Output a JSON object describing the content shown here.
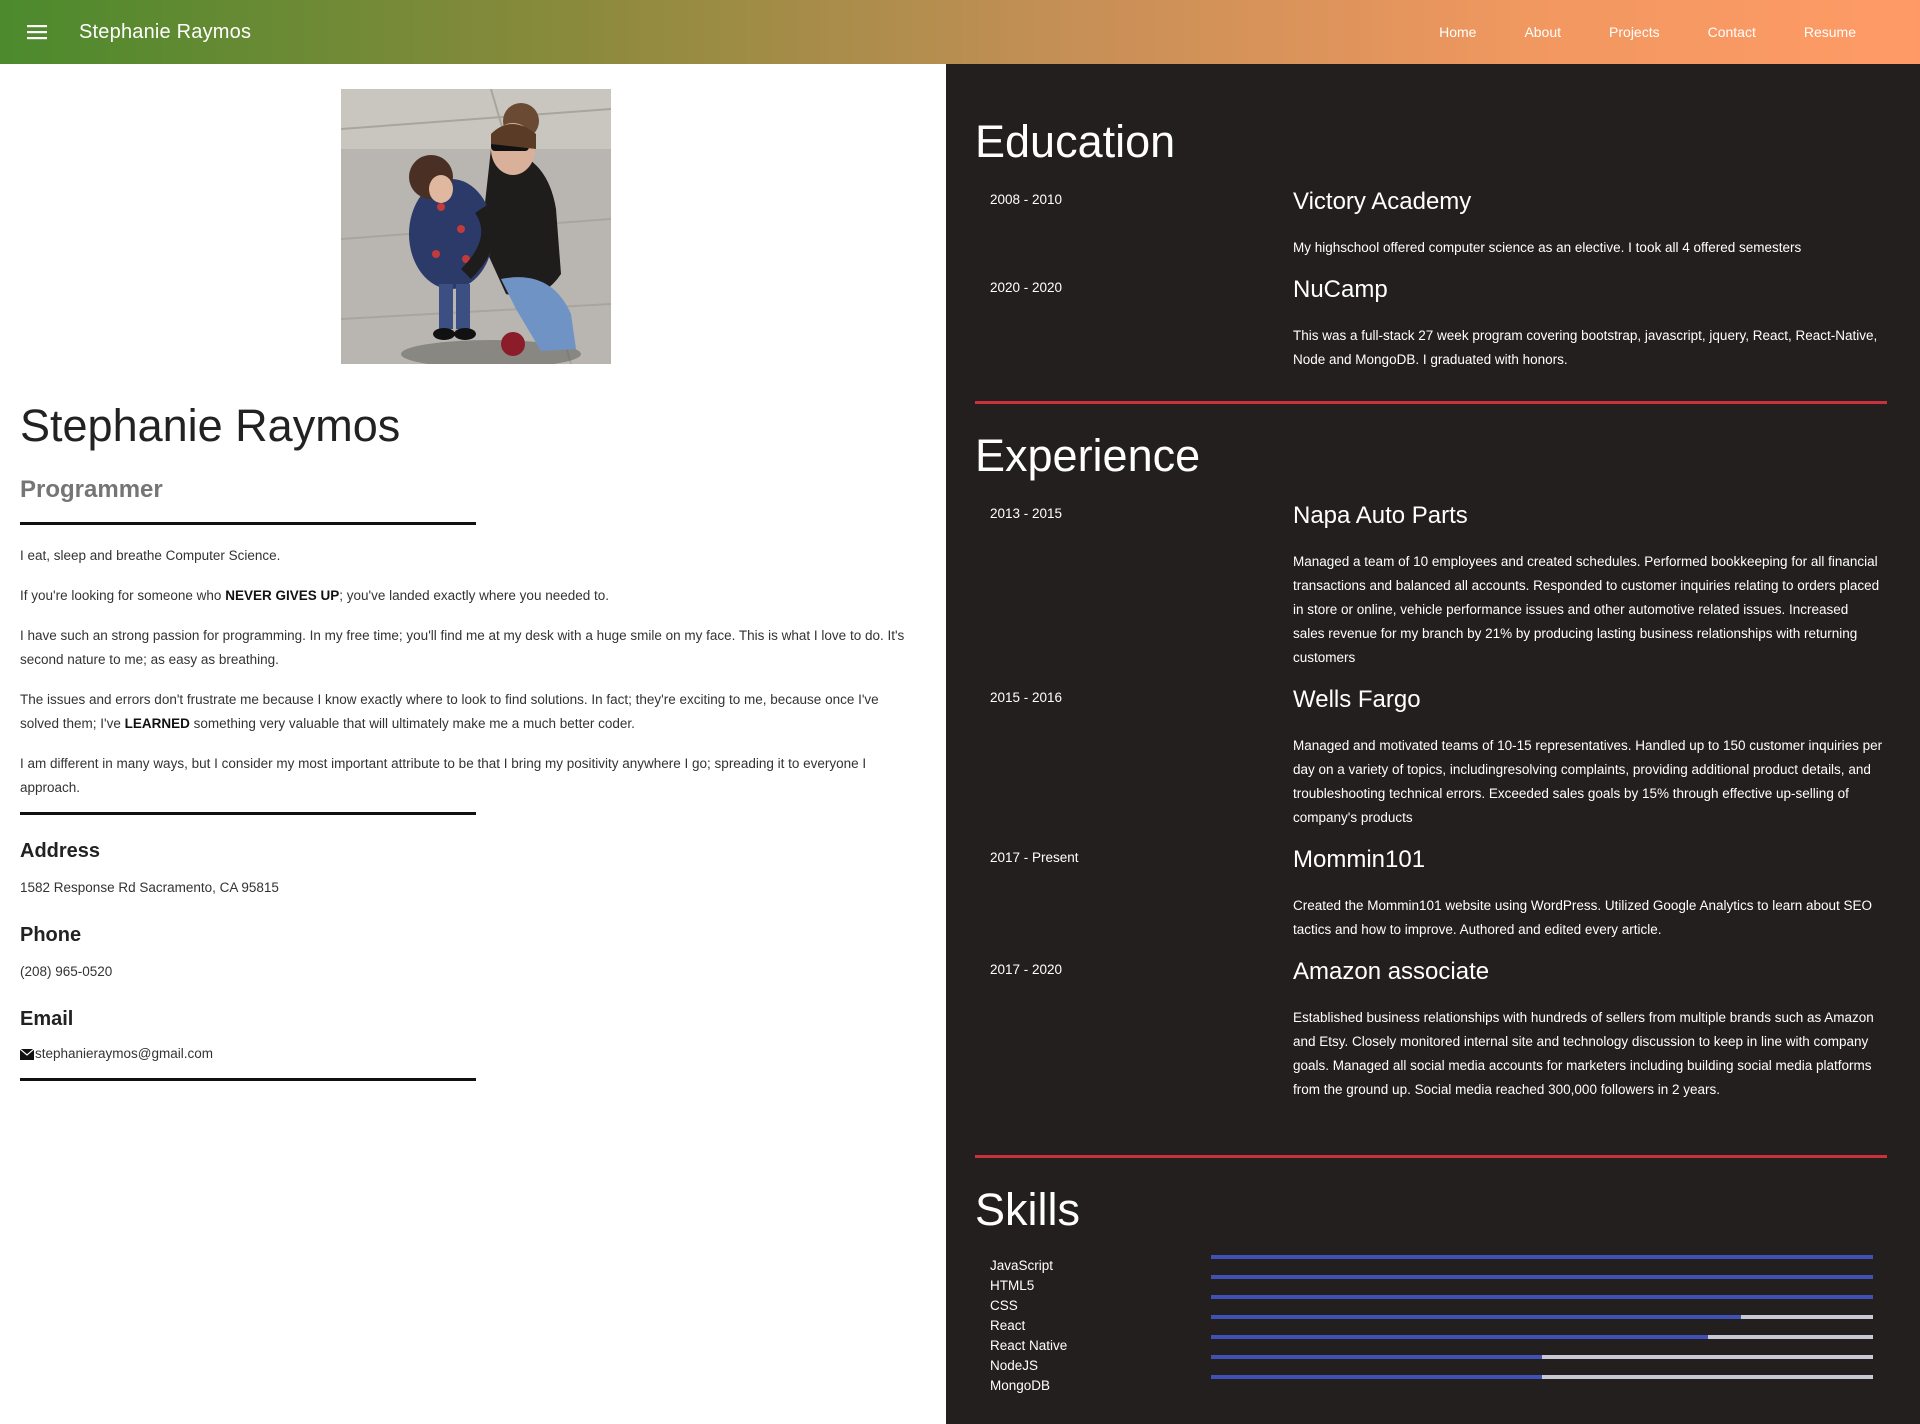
{
  "header": {
    "brand": "Stephanie Raymos",
    "nav": [
      "Home",
      "About",
      "Projects",
      "Contact",
      "Resume"
    ]
  },
  "profile": {
    "name": "Stephanie Raymos",
    "role": "Programmer",
    "bio": {
      "p1": "I eat, sleep and breathe Computer Science.",
      "p2_a": "If you're looking for someone who ",
      "p2_b": "NEVER GIVES UP",
      "p2_c": "; you've landed exactly where you needed to.",
      "p3": "I have such an strong passion for programming. In my free time; you'll find me at my desk with a huge smile on my face. This is what I love to do. It's second nature to me; as easy as breathing.",
      "p4_a": "The issues and errors don't frustrate me because I know exactly where to look to find solutions. In fact; they're exciting to me, because once I've solved them; I've ",
      "p4_b": "LEARNED",
      "p4_c": " something very valuable that will ultimately make me a much better coder.",
      "p5": "I am different in many ways, but I consider my most important attribute to be that I bring my positivity anywhere I go; spreading it to everyone I approach."
    },
    "address_label": "Address",
    "address": "1582 Response Rd Sacramento, CA 95815",
    "phone_label": "Phone",
    "phone": "(208) 965-0520",
    "email_label": "Email",
    "email": "stephanieraymos@gmail.com"
  },
  "education": {
    "title": "Education",
    "items": [
      {
        "dates": "2008 - 2010",
        "title": "Victory Academy",
        "desc": "My highschool offered computer science as an elective. I took all 4 offered semesters"
      },
      {
        "dates": "2020 - 2020",
        "title": "NuCamp",
        "desc": "This was a full-stack 27 week program covering bootstrap, javascript, jquery, React, React-Native, Node and MongoDB. I graduated with honors."
      }
    ]
  },
  "experience": {
    "title": "Experience",
    "items": [
      {
        "dates": "2013 - 2015",
        "title": "Napa Auto Parts",
        "desc": "Managed a team of 10 employees and created schedules. Performed bookkeeping for all financial transactions and balanced all accounts. Responded to customer inquiries relating to orders placed in store or online, vehicle performance issues and other automotive related issues. Increased sales revenue for my branch by 21% by producing lasting business relationships with returning customers"
      },
      {
        "dates": "2015 - 2016",
        "title": "Wells Fargo",
        "desc": "Managed and motivated teams of 10-15 representatives. Handled up to 150 customer inquiries per day on a variety of topics, includingresolving complaints, providing additional product details, and troubleshooting technical errors. Exceeded sales goals by 15% through effective up-selling of company's products"
      },
      {
        "dates": "2017 - Present",
        "title": "Mommin101",
        "desc": "Created the Mommin101 website using WordPress. Utilized Google Analytics to learn about SEO tactics and how to improve. Authored and edited every article."
      },
      {
        "dates": "2017 - 2020",
        "title": "Amazon associate",
        "desc": "Established business relationships with hundreds of sellers from multiple brands such as Amazon and Etsy. Closely monitored internal site and technology discussion to keep in line with company goals. Managed all social media accounts for marketers including building social media platforms from the ground up. Social media reached 300,000 followers in 2 years."
      }
    ]
  },
  "skills": {
    "title": "Skills",
    "items": [
      {
        "name": "JavaScript",
        "level": 1.0
      },
      {
        "name": "HTML5",
        "level": 1.0
      },
      {
        "name": "CSS",
        "level": 1.0
      },
      {
        "name": "React",
        "level": 0.8
      },
      {
        "name": "React Native",
        "level": 0.75
      },
      {
        "name": "NodeJS",
        "level": 0.5
      },
      {
        "name": "MongoDB",
        "level": 0.5
      }
    ]
  },
  "colors": {
    "accent_red": "#c8313d",
    "skill_fill": "#3f51b5",
    "dark_bg": "#231f1e"
  },
  "icons": {
    "menu": "hamburger-menu-icon",
    "email": "envelope-icon"
  }
}
